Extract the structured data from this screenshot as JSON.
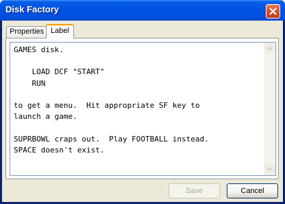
{
  "window": {
    "title": "Disk Factory"
  },
  "tabs": [
    {
      "label": "Properties",
      "selected": false
    },
    {
      "label": "Label",
      "selected": true
    }
  ],
  "label_text": "GAMES disk.\n\n    LOAD DCF \"START\"\n    RUN\n\nto get a menu.  Hit appropriate SF key to\nlaunch a game.\n\nSUPRBOWL craps out.  Play FOOTBALL instead.\nSPACE doesn't exist.",
  "buttons": {
    "save": "Save",
    "cancel": "Cancel"
  },
  "icons": {
    "close": "close-icon",
    "scroll_up": "arrow-up-icon",
    "scroll_down": "arrow-down-icon"
  },
  "colors": {
    "titlebar": "#0054e3",
    "close": "#d9512c",
    "tab_highlight": "#ff9c00",
    "face": "#ece9d8"
  }
}
